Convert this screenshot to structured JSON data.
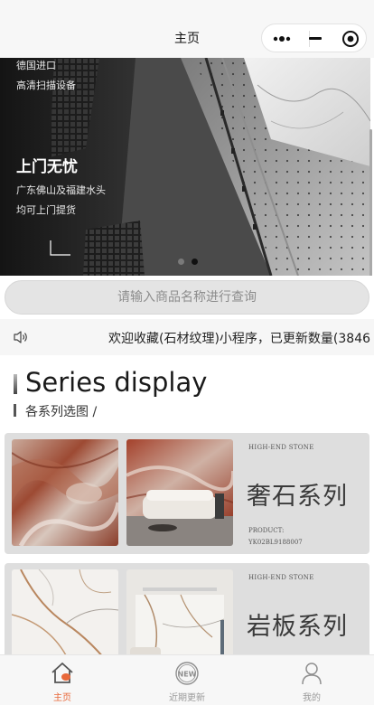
{
  "navbar": {
    "title": "主页",
    "more_icon": "more-dots-icon",
    "minimize_icon": "minimize-icon",
    "close_icon": "target-circle-icon"
  },
  "banner": {
    "line1": "德国进口",
    "line2": "高清扫描设备",
    "headline": "上门无忧",
    "sub1": "广东佛山及福建水头",
    "sub2": "均可上门提货",
    "slides": 2,
    "active_slide": 2
  },
  "search": {
    "placeholder": "请输入商品名称进行查询"
  },
  "notice": {
    "icon": "speaker-icon",
    "text": "欢迎收藏(石材纹理)小程序，已更新数量(3846"
  },
  "section": {
    "title": "Series display",
    "subtitle": "各系列选图 /"
  },
  "series": [
    {
      "tag": "HIGH-END STONE",
      "name": "奢石系列",
      "code_label": "PRODUCT:",
      "code": "YK02BL9188007"
    },
    {
      "tag": "HIGH-END STONE",
      "name": "岩板系列"
    }
  ],
  "tabbar": {
    "items": [
      {
        "label": "主页",
        "icon": "home-icon",
        "active": true
      },
      {
        "label": "近期更新",
        "icon": "new-badge-icon",
        "active": false
      },
      {
        "label": "我的",
        "icon": "user-icon",
        "active": false
      }
    ],
    "active_color": "#e8683a",
    "inactive_color": "#9a9a9a"
  }
}
